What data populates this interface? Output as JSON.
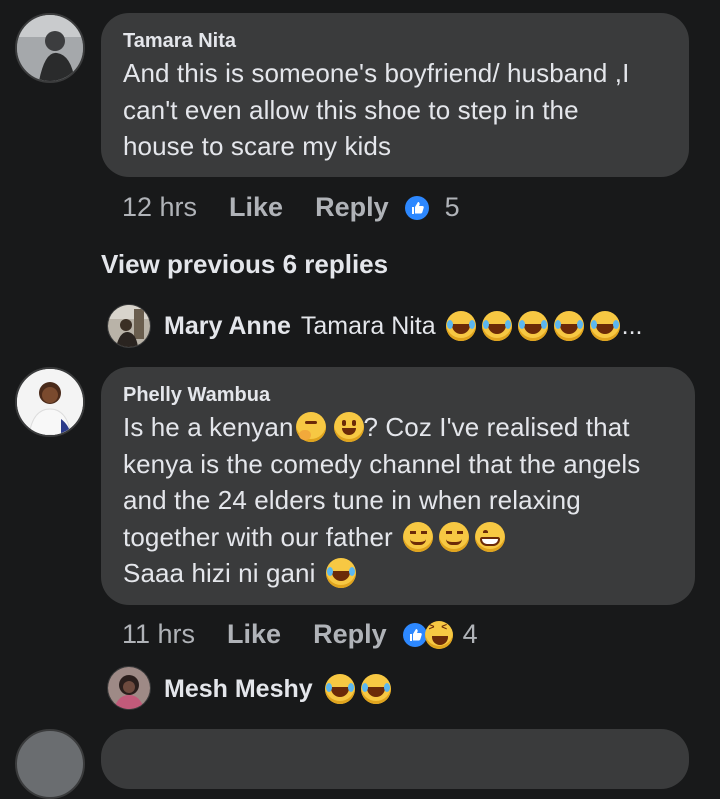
{
  "comment1": {
    "author": "Tamara Nita",
    "lines": [
      "And this is someone's boyfriend/ husband ,I",
      "can't even allow this shoe to step in the",
      "house to scare my kids"
    ],
    "time": "12 hrs",
    "like_label": "Like",
    "reply_label": "Reply",
    "reaction_count": "5",
    "reactions": [
      "like-icon"
    ]
  },
  "view_previous": "View previous 6 replies",
  "reply1": {
    "author": "Mary Anne",
    "text": "Tamara Nita",
    "emojis": [
      "tears-of-joy-icon",
      "tears-of-joy-icon",
      "tears-of-joy-icon",
      "tears-of-joy-icon",
      "tears-of-joy-icon"
    ],
    "ellipsis": "..."
  },
  "comment2": {
    "author": "Phelly Wambua",
    "line1_a": "Is he a kenyan",
    "line1_b": "? Coz I've realised that",
    "line2": "kenya is the comedy channel that the angels",
    "line3": "and the 24 elders tune in when  relaxing",
    "line4": "together with our father",
    "line5": "Saaa hizi ni gani",
    "time": "11 hrs",
    "like_label": "Like",
    "reply_label": "Reply",
    "reaction_count": "4",
    "reactions": [
      "like-icon",
      "laughing-icon"
    ]
  },
  "reply2": {
    "author": "Mesh Meshy",
    "emojis": [
      "tears-of-joy-icon",
      "tears-of-joy-icon"
    ]
  },
  "colors": {
    "background": "#18191a",
    "bubble": "#3a3b3c",
    "text": "#e4e6eb",
    "meta": "#b0b3b8",
    "like_blue": "#2d88ff"
  }
}
